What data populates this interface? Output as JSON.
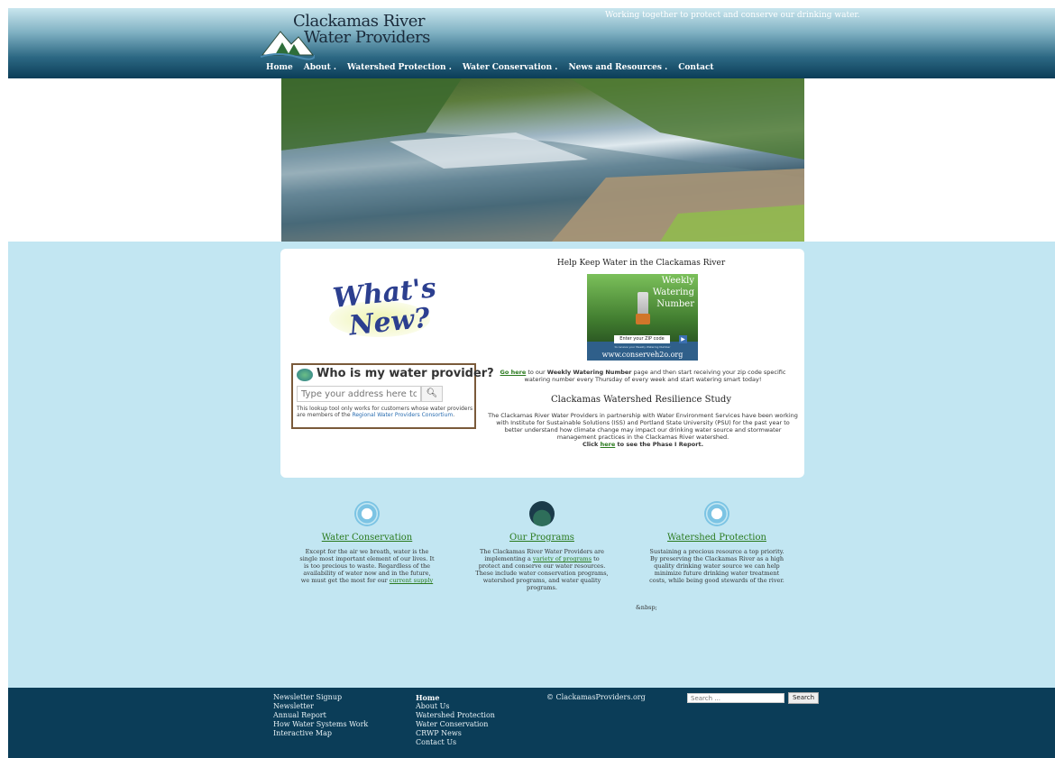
{
  "header": {
    "logo_line1": "Clackamas River",
    "logo_line2": "Water Providers",
    "tagline": "Working together to protect and conserve our drinking water.",
    "nav": [
      {
        "label": "Home"
      },
      {
        "label": "About ."
      },
      {
        "label": "Watershed Protection ."
      },
      {
        "label": "Water Conservation ."
      },
      {
        "label": "News and Resources ."
      },
      {
        "label": "Contact"
      }
    ]
  },
  "whats_new": {
    "line1": "What's",
    "line2": "New?"
  },
  "provider_lookup": {
    "title": "Who is my water provider?",
    "placeholder": "Type your address here to ch",
    "note_prefix": "This lookup tool only works for customers whose water providers are members of the ",
    "note_link": "Regional Water Providers Consortium",
    "note_suffix": "."
  },
  "right": {
    "heading1": "Help Keep Water in the Clackamas River",
    "banner": {
      "line1": "Weekly",
      "line2": "Watering",
      "line3": "Number",
      "zip_label": "Enter your ZIP code",
      "small": "to receive your Weekly Watering Number",
      "url": "www.conserveh2o.org"
    },
    "text1_link": "Go here",
    "text1_mid": " to our ",
    "text1_bold": "Weekly Watering Number",
    "text1_rest": " page and then start receiving your zip code specific watering number every Thursday of every week and start watering smart today!",
    "heading2": "Clackamas Watershed Resilience Study",
    "text2": "The Clackamas River Water Providers in partnership with Water Environment Services have been working with Institute for Sustainable Solutions (ISS) and Portland State University (PSU) for the past year to better understand how climate change may impact our drinking water source and stormwater management practices in the Clackamas River watershed.",
    "text2_click": "Click ",
    "text2_link": "here",
    "text2_end": " to see the Phase I Report."
  },
  "columns": [
    {
      "heading": "Water Conservation",
      "body": "Except for the air we breath, water is the single most important element of our lives. It is too precious to waste. Regardless of the availability of water now and in the future, we must get the most for our ",
      "link": "current supply",
      "body_end": ""
    },
    {
      "heading": "Our Programs",
      "body": "The Clackamas River Water Providers are implementing a ",
      "link": "variety of programs",
      "body_end": " to protect and conserve our water resources. These include water conservation programs, watershed programs, and water quality programs."
    },
    {
      "heading": "Watershed Protection",
      "body": "Sustaining a precious resource a top priority. By preserving the Clackamas River as a high quality drinking water source we can help minimize future drinking water treatment costs, while being good stewards of the river.",
      "link": "",
      "body_end": ""
    }
  ],
  "nbsp": "&nbsp;",
  "footer": {
    "col1": [
      "Newsletter Signup",
      "Newsletter",
      "Annual Report",
      "How Water Systems Work",
      "Interactive Map"
    ],
    "col2": [
      "Home",
      "About Us",
      "Watershed Protection",
      "Water Conservation",
      "CRWP News",
      "Contact Us"
    ],
    "copyright": "© ClackamasProviders.org",
    "search_placeholder": "Search ...",
    "search_button": "Search"
  }
}
